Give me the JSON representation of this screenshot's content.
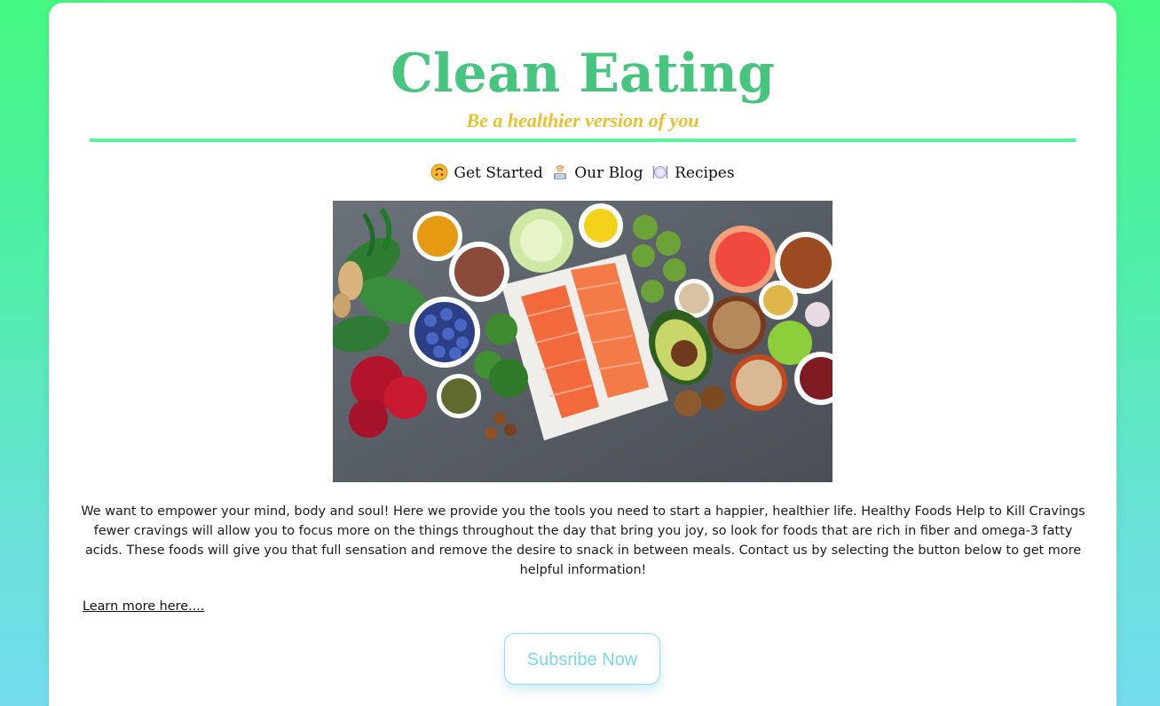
{
  "header": {
    "title": "Clean Eating",
    "tagline": "Be a healthier version of you"
  },
  "nav": {
    "items": [
      {
        "label": "Get Started",
        "icon": "upside-down-face-emoji"
      },
      {
        "label": "Our Blog",
        "icon": "person-at-laptop-emoji"
      },
      {
        "label": "Recipes",
        "icon": "plate-with-cutlery-emoji"
      }
    ]
  },
  "hero": {
    "image": "healthy-foods-flatlay-salmon-vegetables-nuts"
  },
  "main": {
    "paragraph": "We want to empower your mind, body and soul! Here we provide you the tools you need to start a happier, healthier life. Healthy Foods Help to Kill Cravings fewer cravings will allow you to focus more on the things throughout the day that bring you joy, so look for foods that are rich in fiber and omega-3 fatty acids. These foods will give you that full sensation and remove the desire to snack in between meals. Contact us by selecting the button below to get more helpful information!",
    "learn_more": "Learn more here....",
    "subscribe_label": "Subsribe Now"
  },
  "colors": {
    "title": "#47c57f",
    "tagline": "#e8c12b",
    "divider": "#55f59a",
    "button_text": "#7cd6ea",
    "background_top": "#45f882",
    "background_bottom": "#74dcee"
  }
}
